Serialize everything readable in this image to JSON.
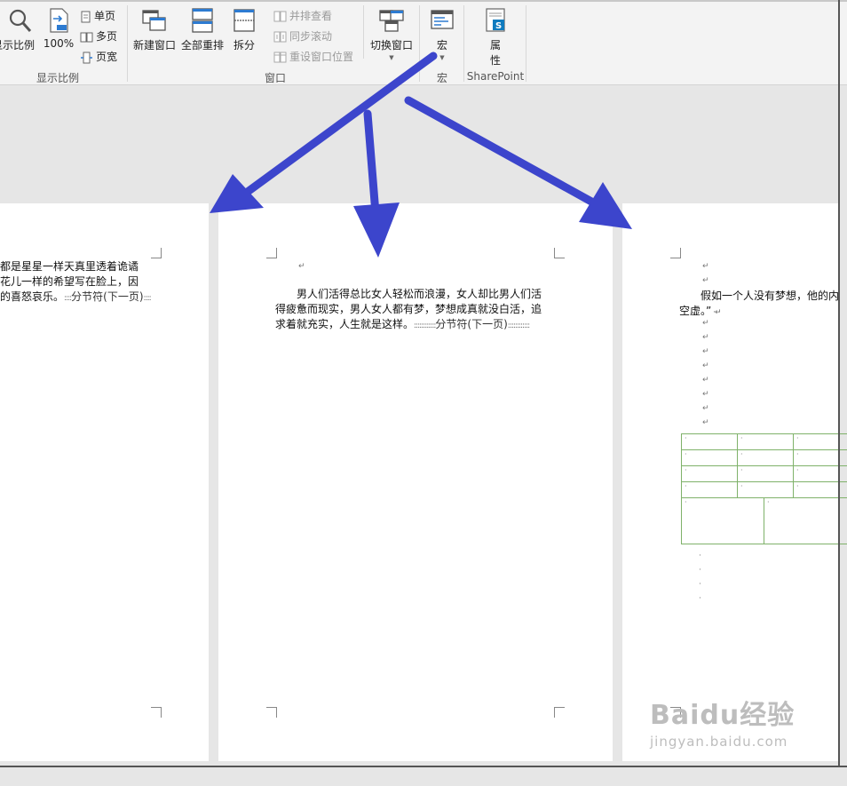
{
  "ribbon": {
    "zoom_group": {
      "zoom_label": "显示比例",
      "zoom100_label": "100%",
      "single_page": "单页",
      "multi_page": "多页",
      "page_width": "页宽",
      "group_label": "显示比例"
    },
    "window_group": {
      "new_window": "新建窗口",
      "arrange_all": "全部重排",
      "split": "拆分",
      "side_by_side": "并排查看",
      "sync_scroll": "同步滚动",
      "reset_position": "重设窗口位置",
      "switch_window": "切换窗口",
      "group_label": "窗口"
    },
    "macro_group": {
      "macro": "宏",
      "group_label": "宏"
    },
    "sharepoint_group": {
      "properties_line1": "属",
      "properties_line2": "性",
      "group_label": "SharePoint"
    }
  },
  "pages": {
    "left": {
      "line1": "都是星星一样天真里透着诡谲",
      "line2": "花儿一样的希望写在脸上，因",
      "line3": "的喜怒哀乐。",
      "section_break": "分节符(下一页)"
    },
    "middle": {
      "line1": "男人们活得总比女人轻松而浪漫，女人却比男人们活",
      "line2": "得疲惫而现实，男人女人都有梦，梦想成真就没白活，追",
      "line3": "求着就充实，人生就是这样。",
      "section_break": "分节符(下一页)"
    },
    "right": {
      "line1": "假如一个人没有梦想，他的内",
      "line2": "空虚。”"
    }
  },
  "watermark": {
    "logo": "Baidu经验",
    "sub": "jingyan.baidu.com"
  },
  "colors": {
    "arrow": "#3c45cc",
    "table_border": "#7fb26a",
    "ribbon_bg": "#f3f3f3"
  }
}
